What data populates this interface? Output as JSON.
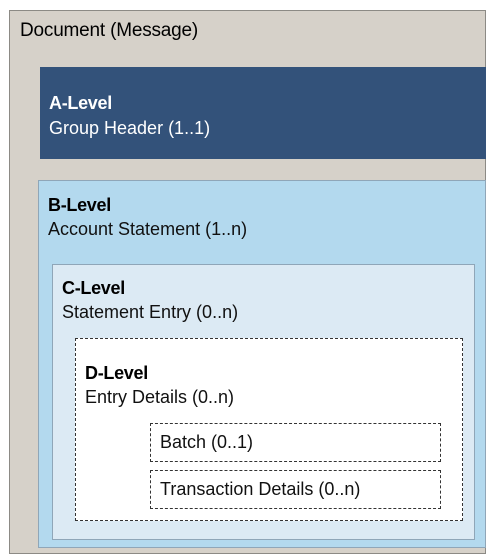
{
  "document": {
    "title": "Document (Message)"
  },
  "levels": {
    "a": {
      "name": "A-Level",
      "desc": "Group Header (1..1)"
    },
    "b": {
      "name": "B-Level",
      "desc": "Account Statement (1..n)"
    },
    "c": {
      "name": "C-Level",
      "desc": "Statement Entry (0..n)"
    },
    "d": {
      "name": "D-Level",
      "desc": "Entry Details (0..n)"
    }
  },
  "sub_blocks": {
    "batch": "Batch (0..1)",
    "transaction": "Transaction Details (0..n)"
  },
  "colors": {
    "document_bg": "#d6d1c9",
    "level_a_bg": "#33527a",
    "level_b_bg": "#b3d9ee",
    "level_c_bg": "#dceaf4",
    "level_d_bg": "#ffffff"
  }
}
